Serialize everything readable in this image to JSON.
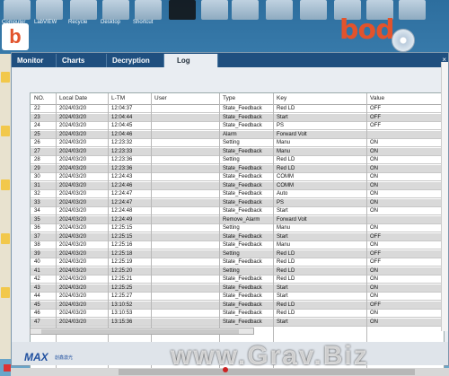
{
  "desktop": {
    "icons": [
      "Computer",
      "LabVIEW",
      "Recycle",
      "Desktop",
      "Shortcut",
      "bod",
      "folder",
      "folder",
      "folder",
      "folder",
      "folder",
      "folder",
      "startup"
    ],
    "brand": "bod"
  },
  "app": {
    "logo_letter": "b",
    "tabs": [
      {
        "label": "Monitor"
      },
      {
        "label": "Charts"
      },
      {
        "label": "Decryption"
      },
      {
        "label": "Log"
      }
    ],
    "close_glyph": "×"
  },
  "log_table": {
    "columns": [
      "NO.",
      "Local Date",
      "L-TM",
      "User",
      "Type",
      "Key",
      "Value"
    ],
    "rows": [
      [
        "22",
        "2024/03/20",
        "12:04:37",
        "",
        "State_Feedback",
        "Red LD",
        "OFF"
      ],
      [
        "23",
        "2024/03/20",
        "12:04:44",
        "",
        "State_Feedback",
        "Start",
        "OFF"
      ],
      [
        "24",
        "2024/03/20",
        "12:04:45",
        "",
        "State_Feedback",
        "PS",
        "OFF"
      ],
      [
        "25",
        "2024/03/20",
        "12:04:46",
        "",
        "Alarm",
        "Forward Volt",
        ""
      ],
      [
        "26",
        "2024/03/20",
        "12:23:32",
        "",
        "Setting",
        "Manu",
        "ON"
      ],
      [
        "27",
        "2024/03/20",
        "12:23:33",
        "",
        "State_Feedback",
        "Manu",
        "ON"
      ],
      [
        "28",
        "2024/03/20",
        "12:23:36",
        "",
        "Setting",
        "Red LD",
        "ON"
      ],
      [
        "29",
        "2024/03/20",
        "12:23:36",
        "",
        "State_Feedback",
        "Red LD",
        "ON"
      ],
      [
        "30",
        "2024/03/20",
        "12:24:43",
        "",
        "State_Feedback",
        "COMM",
        "ON"
      ],
      [
        "31",
        "2024/03/20",
        "12:24:46",
        "",
        "State_Feedback",
        "COMM",
        "ON"
      ],
      [
        "32",
        "2024/03/20",
        "12:24:47",
        "",
        "State_Feedback",
        "Auto",
        "ON"
      ],
      [
        "33",
        "2024/03/20",
        "12:24:47",
        "",
        "State_Feedback",
        "PS",
        "ON"
      ],
      [
        "34",
        "2024/03/20",
        "12:24:48",
        "",
        "State_Feedback",
        "Start",
        "ON"
      ],
      [
        "35",
        "2024/03/20",
        "12:24:49",
        "",
        "Remove_Alarm",
        "Forward Volt",
        ""
      ],
      [
        "36",
        "2024/03/20",
        "12:25:15",
        "",
        "Setting",
        "Manu",
        "ON"
      ],
      [
        "37",
        "2024/03/20",
        "12:25:15",
        "",
        "State_Feedback",
        "Start",
        "OFF"
      ],
      [
        "38",
        "2024/03/20",
        "12:25:16",
        "",
        "State_Feedback",
        "Manu",
        "ON"
      ],
      [
        "39",
        "2024/03/20",
        "12:25:18",
        "",
        "Setting",
        "Red LD",
        "OFF"
      ],
      [
        "40",
        "2024/03/20",
        "12:25:19",
        "",
        "State_Feedback",
        "Red LD",
        "OFF"
      ],
      [
        "41",
        "2024/03/20",
        "12:25:20",
        "",
        "Setting",
        "Red LD",
        "ON"
      ],
      [
        "42",
        "2024/03/20",
        "12:25:21",
        "",
        "State_Feedback",
        "Red LD",
        "ON"
      ],
      [
        "43",
        "2024/03/20",
        "12:25:25",
        "",
        "State_Feedback",
        "Start",
        "ON"
      ],
      [
        "44",
        "2024/03/20",
        "12:25:27",
        "",
        "State_Feedback",
        "Start",
        "ON"
      ],
      [
        "45",
        "2024/03/20",
        "13:10:52",
        "",
        "State_Feedback",
        "Red LD",
        "OFF"
      ],
      [
        "46",
        "2024/03/20",
        "13:10:53",
        "",
        "State_Feedback",
        "Red LD",
        "ON"
      ],
      [
        "47",
        "2024/03/20",
        "13:15:36",
        "",
        "State_Feedback",
        "Start",
        "ON"
      ]
    ]
  },
  "footer": {
    "logo": "MAX",
    "logo_sub": "創鑫激光"
  },
  "watermark": "www.Grav.Biz"
}
